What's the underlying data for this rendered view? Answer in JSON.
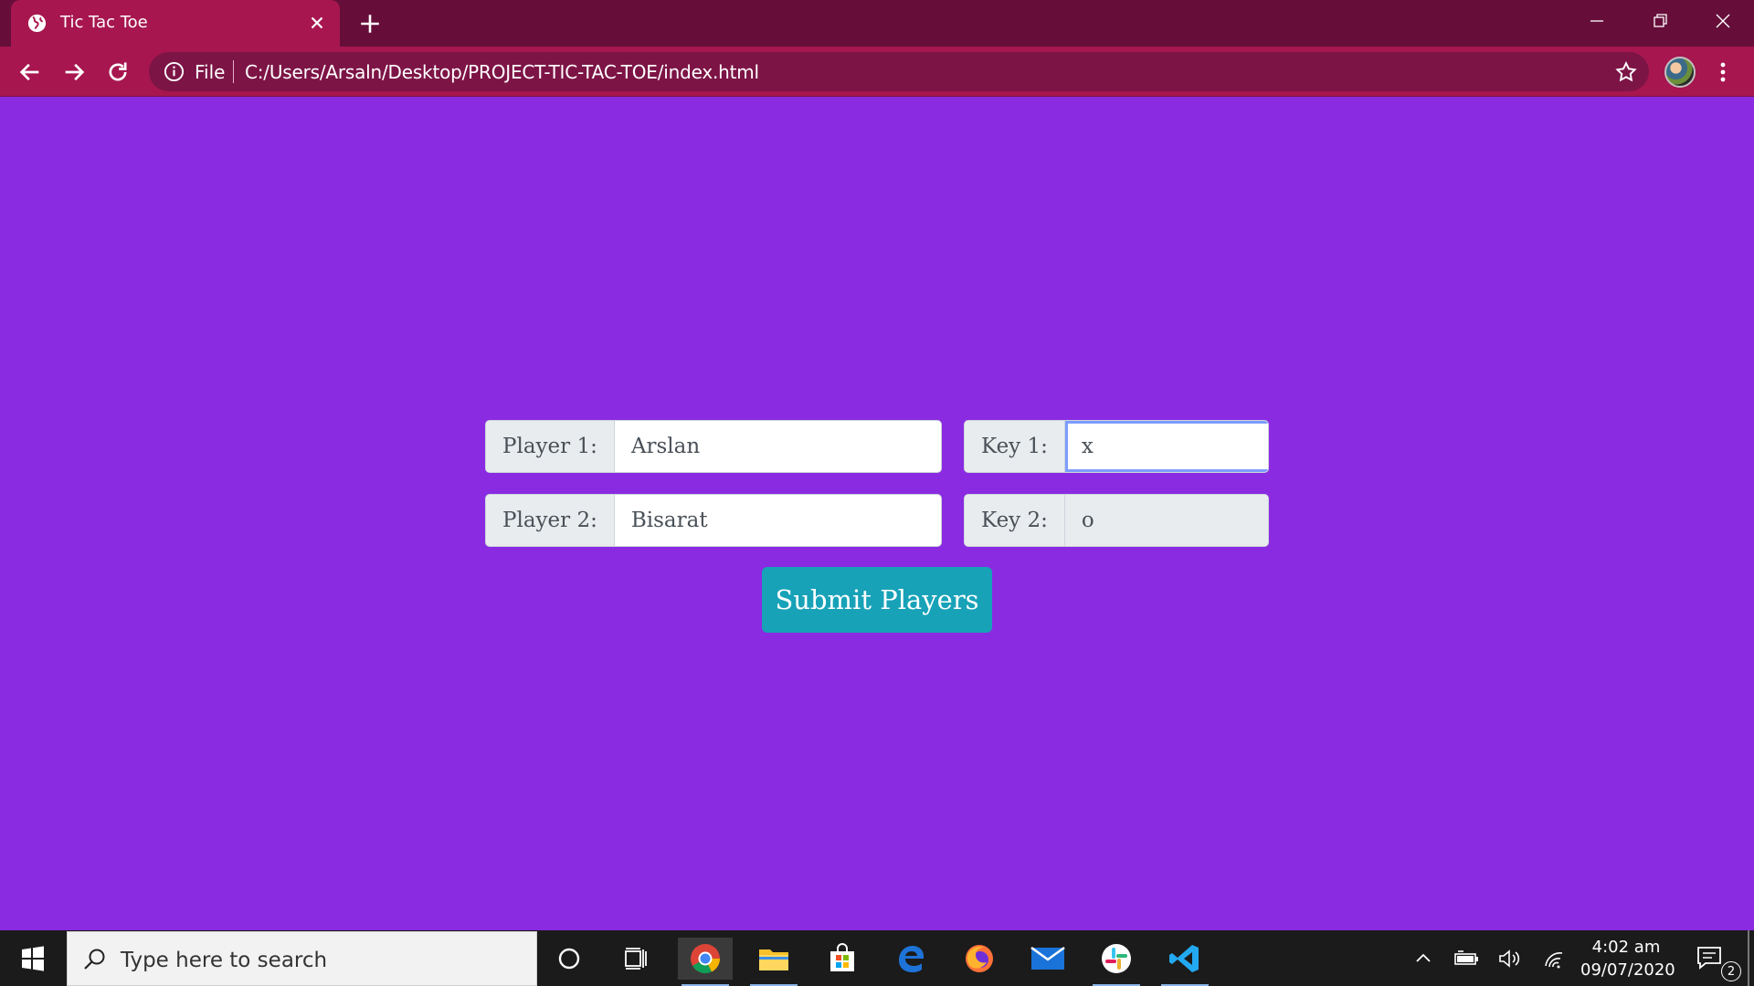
{
  "browser": {
    "tab_title": "Tic Tac Toe",
    "security_label": "File",
    "url": "C:/Users/Arsaln/Desktop/PROJECT-TIC-TAC-TOE/index.html",
    "tab_color": "#a7164f",
    "frame_color": "#660e39"
  },
  "form": {
    "player1_label": "Player 1:",
    "player1_value": "Arslan",
    "player2_label": "Player 2:",
    "player2_value": "Bisarat",
    "key1_label": "Key 1:",
    "key1_value": "x",
    "key2_label": "Key 2:",
    "key2_value": "o",
    "submit_label": "Submit Players",
    "page_background": "#8a2be2",
    "button_color": "#17a2b8"
  },
  "taskbar": {
    "search_placeholder": "Type here to search",
    "time": "4:02 am",
    "date": "09/07/2020",
    "notification_count": "2",
    "pinned_apps": [
      "chrome-icon",
      "file-explorer-icon",
      "store-icon",
      "edge-icon",
      "firefox-icon",
      "mail-icon",
      "slack-icon",
      "vscode-icon"
    ]
  }
}
